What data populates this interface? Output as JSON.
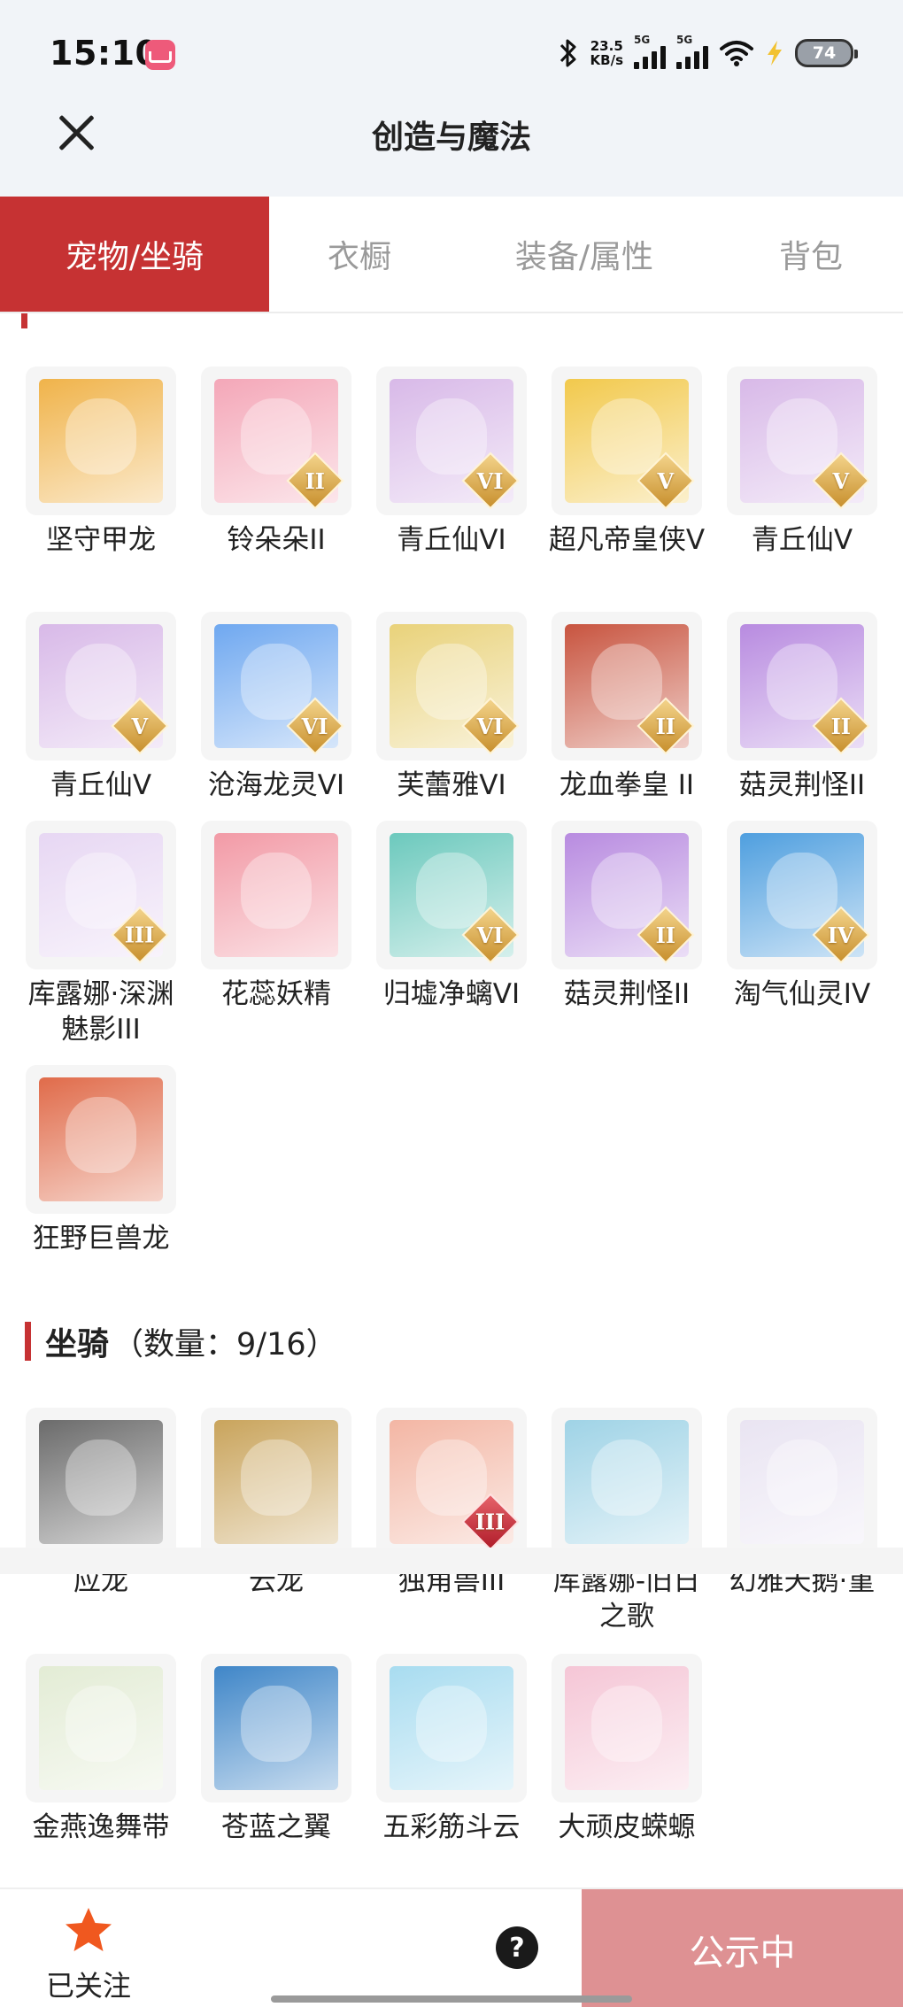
{
  "status_bar": {
    "time": "15:10",
    "net_speed_value": "23.5",
    "net_speed_unit": "KB/s",
    "signal1_label": "5G",
    "signal2_label": "5G",
    "battery": "74",
    "icons": [
      "app-notification-icon",
      "bluetooth-icon",
      "signal-icon",
      "wifi-icon",
      "charging-icon",
      "battery-icon"
    ]
  },
  "nav": {
    "title": "创造与魔法",
    "close_icon": "close-icon"
  },
  "tabs": [
    {
      "label": "宠物/坐骑",
      "active": true
    },
    {
      "label": "衣橱",
      "active": false
    },
    {
      "label": "装备/属性",
      "active": false
    },
    {
      "label": "背包",
      "active": false
    }
  ],
  "pets": {
    "items": [
      {
        "name": "坚守甲龙",
        "badge": "",
        "bg": "#f0b34a"
      },
      {
        "name": "铃朵朵II",
        "badge": "II",
        "bg": "#f4a7b8"
      },
      {
        "name": "青丘仙VI",
        "badge": "VI",
        "bg": "#d8b9e8"
      },
      {
        "name": "超凡帝皇侠V",
        "badge": "V",
        "bg": "#f2c94c"
      },
      {
        "name": "青丘仙V",
        "badge": "V",
        "bg": "#d8b9e8"
      },
      {
        "name": "青丘仙V",
        "badge": "V",
        "bg": "#d8b9e8"
      },
      {
        "name": "沧海龙灵VI",
        "badge": "VI",
        "bg": "#6fa8f0"
      },
      {
        "name": "芙蕾雅VI",
        "badge": "VI",
        "bg": "#e9d27a"
      },
      {
        "name": "龙血拳皇 II",
        "badge": "II",
        "bg": "#c8543f"
      },
      {
        "name": "菇灵荆怪II",
        "badge": "II",
        "bg": "#b88be0"
      },
      {
        "name": "库露娜·深渊魅影III",
        "badge": "III",
        "bg": "#e7d7f3"
      },
      {
        "name": "花蕊妖精",
        "badge": "",
        "bg": "#f29aa6"
      },
      {
        "name": "归墟净螭VI",
        "badge": "VI",
        "bg": "#6cc9bd"
      },
      {
        "name": "菇灵荆怪II",
        "badge": "II",
        "bg": "#b88be0"
      },
      {
        "name": "淘气仙灵IV",
        "badge": "IV",
        "bg": "#4f9fdf"
      },
      {
        "name": "狂野巨兽龙",
        "badge": "",
        "bg": "#e06b4a"
      }
    ]
  },
  "mounts": {
    "title": "坐骑",
    "count_text": "（数量：9/16）",
    "items": [
      {
        "name": "应龙",
        "badge": "",
        "bg": "#6b6b6b"
      },
      {
        "name": "云龙",
        "badge": "",
        "bg": "#c9a45c"
      },
      {
        "name": "独角兽III",
        "badge": "III",
        "badge_style": "red",
        "bg": "#f3b6a4"
      },
      {
        "name": "库露娜-旧日之歌",
        "badge": "",
        "bg": "#9fd3e6"
      },
      {
        "name": "幻雅天鹅·堇",
        "badge": "",
        "bg": "#e9e4f2"
      },
      {
        "name": "金燕逸舞带",
        "badge": "",
        "bg": "#e3ecd5"
      },
      {
        "name": "苍蓝之翼",
        "badge": "",
        "bg": "#3f86c8"
      },
      {
        "name": "五彩筋斗云",
        "badge": "",
        "bg": "#a8dcf0"
      },
      {
        "name": "大顽皮蝾螈",
        "badge": "",
        "bg": "#f5c6d6"
      }
    ]
  },
  "bottom": {
    "follow_label": "已关注",
    "help_label": "?",
    "publish_label": "公示中",
    "accent": "#c63233",
    "star_color": "#f0581f"
  }
}
